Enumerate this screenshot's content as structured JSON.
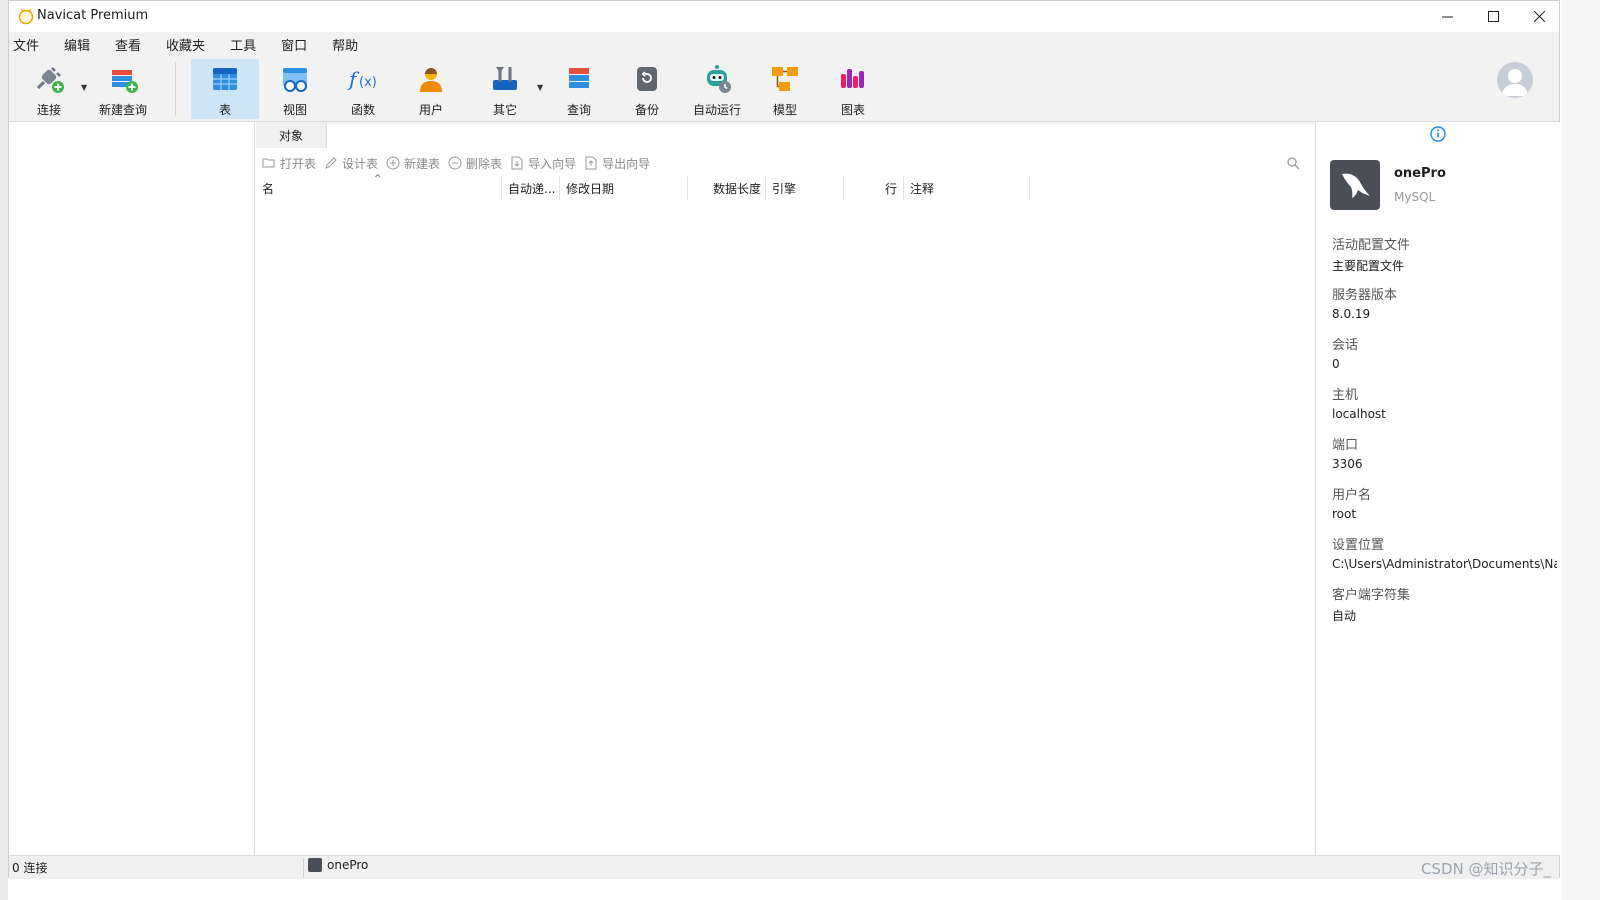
{
  "window": {
    "title": "Navicat Premium"
  },
  "menu": [
    "文件",
    "编辑",
    "查看",
    "收藏夹",
    "工具",
    "窗口",
    "帮助"
  ],
  "toolbar": {
    "connect": "连接",
    "new_query": "新建查询",
    "table": "表",
    "view": "视图",
    "function": "函数",
    "user": "用户",
    "other": "其它",
    "query": "查询",
    "backup": "备份",
    "auto_run": "自动运行",
    "model": "模型",
    "chart": "图表"
  },
  "objects": {
    "tab_label": "对象",
    "actions": {
      "open_table": "打开表",
      "design_table": "设计表",
      "new_table": "新建表",
      "delete_table": "删除表",
      "import_wizard": "导入向导",
      "export_wizard": "导出向导"
    },
    "columns": [
      "名",
      "自动递...",
      "修改日期",
      "数据长度",
      "引擎",
      "行",
      "注释"
    ]
  },
  "info": {
    "connection_name": "onePro",
    "connection_type": "MySQL",
    "properties": [
      {
        "label": "活动配置文件",
        "value": "主要配置文件"
      },
      {
        "label": "服务器版本",
        "value": "8.0.19"
      },
      {
        "label": "会话",
        "value": "0"
      },
      {
        "label": "主机",
        "value": "localhost"
      },
      {
        "label": "端口",
        "value": "3306"
      },
      {
        "label": "用户名",
        "value": "root"
      },
      {
        "label": "设置位置",
        "value": "C:\\Users\\Administrator\\Documents\\Na"
      },
      {
        "label": "客户端字符集",
        "value": "自动"
      }
    ]
  },
  "status": {
    "connections": "0 连接",
    "current_connection": "onePro",
    "watermark": "CSDN @知识分子_"
  },
  "colors": {
    "accent": "#1e88e5",
    "active_tool_bg": "#cde5f7"
  }
}
